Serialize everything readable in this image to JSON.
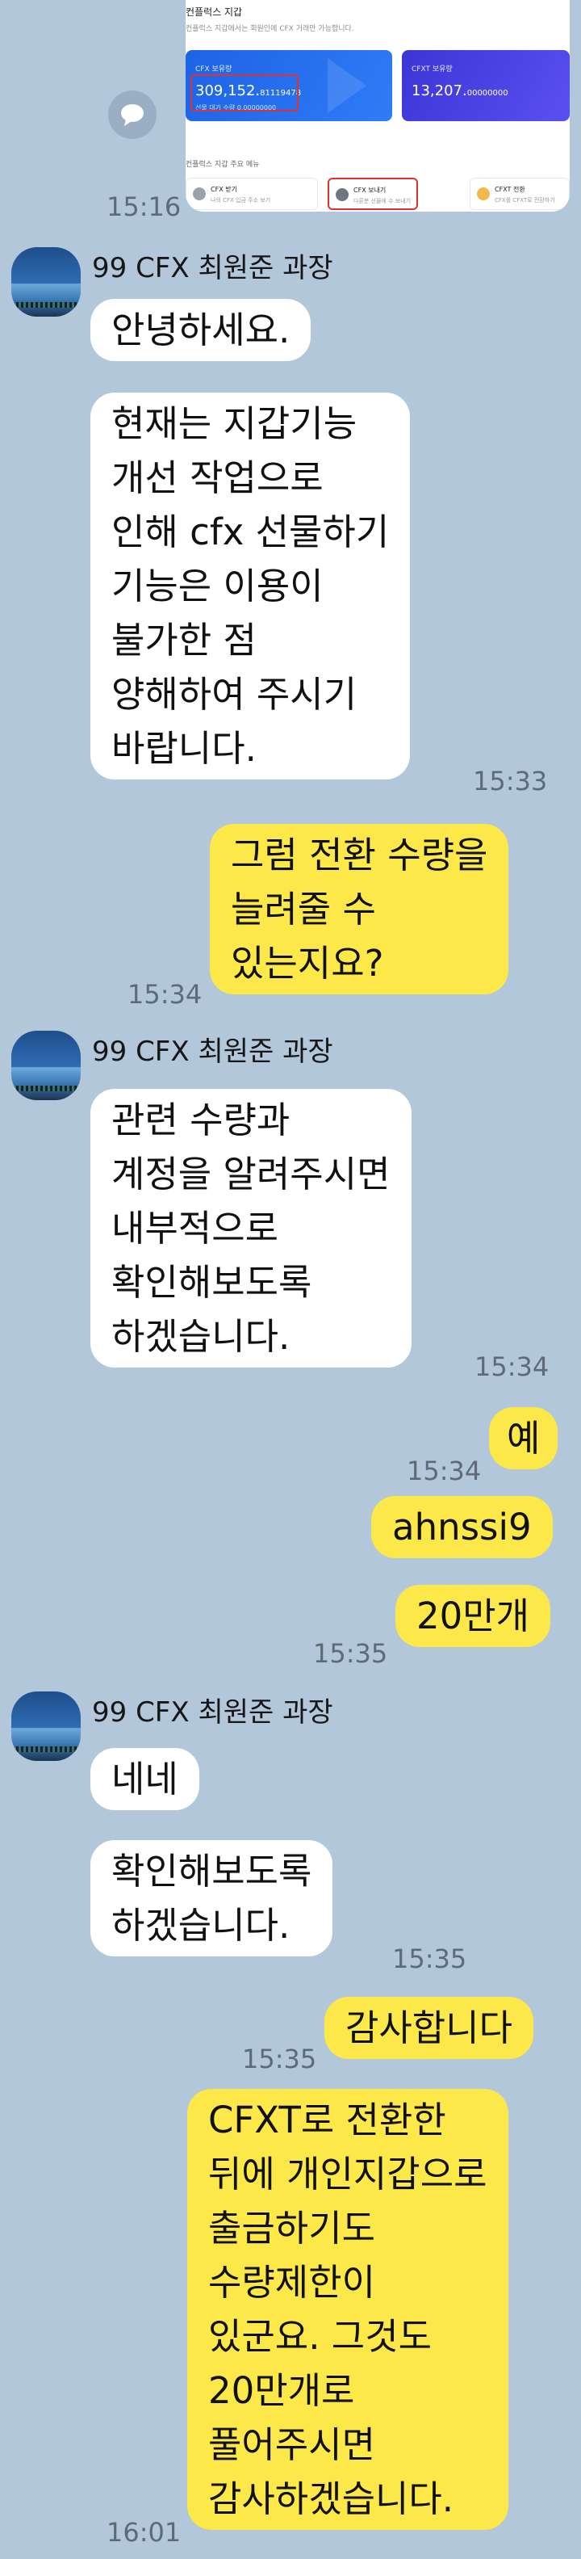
{
  "shared_image": {
    "title": "컨플럭스 지갑",
    "subtitle": "컨플럭스 지갑에서는 회원인에 CFX 거래만 가능합니다.",
    "card_cfx": {
      "label": "CFX 보유량",
      "value_main": "309,152.",
      "value_decimal": "81119478",
      "note": "선물 대기 수량 0,00000000"
    },
    "card_cfxt": {
      "label": "CFXT 보유량",
      "value_main": "13,207.",
      "value_decimal": "00000000"
    },
    "menu_title": "컨플럭스 지갑 주요 메뉴",
    "menu_items": [
      {
        "title": "CFX 받기",
        "desc": "나의 CFX 입금 주소 보기",
        "icon_color": "#9aa3ad"
      },
      {
        "title": "CFX 보내기",
        "desc": "다른분 선물에 수 보내기",
        "icon_color": "#6d7681"
      },
      {
        "title": "CFXT 전환",
        "desc": "CFX를 CFXT로 전환하기",
        "icon_color": "#f2b84b"
      }
    ]
  },
  "share_icon": "speech-bubble-icon",
  "messages_time_top": "15:16",
  "sender_name": "99 CFX 최원준 과장",
  "chat": {
    "m1": "안녕하세요.",
    "m2_lines": [
      "현재는 지갑기능",
      "개선 작업으로",
      "인해 cfx 선물하기",
      "기능은 이용이",
      "불가한 점",
      "양해하여 주시기",
      "바랍니다."
    ],
    "t2": "15:33",
    "m3_lines": [
      "그럼 전환 수량을",
      "늘려줄 수",
      "있는지요?"
    ],
    "t3": "15:34",
    "m4_lines": [
      "관련 수량과",
      "계정을 알려주시면",
      "내부적으로",
      "확인해보도록",
      "하겠습니다."
    ],
    "t4": "15:34",
    "m5": "예",
    "t5": "15:34",
    "m6": "ahnssi9",
    "m7": "20만개",
    "t7": "15:35",
    "m8": "네네",
    "m9_lines": [
      "확인해보도록",
      "하겠습니다."
    ],
    "t9": "15:35",
    "m10": "감사합니다",
    "t10": "15:35",
    "m11_lines": [
      "CFXT로 전환한",
      "뒤에 개인지갑으로",
      "출금하기도",
      "수량제한이",
      "있군요.  그것도",
      "20만개로",
      "풀어주시면",
      "감사하겠습니다."
    ],
    "t11": "16:01"
  },
  "colors": {
    "background": "#b2c7da",
    "incoming_bubble": "#ffffff",
    "outgoing_bubble": "#fde84a",
    "timestamp": "#5d6b78"
  }
}
